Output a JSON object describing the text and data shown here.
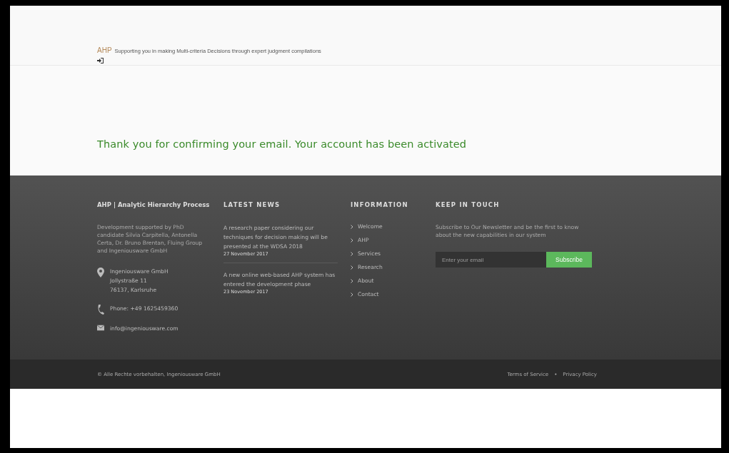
{
  "header": {
    "brand": "AHP",
    "tagline": "Supporting you in making Multi-criteria Decisions through expert judgment compilations"
  },
  "message": "Thank you for confirming your email. Your account has been activated",
  "footer": {
    "about": {
      "title": "AHP | Analytic Hierarchy Process",
      "text": "Development supported by PhD candidate Silvia Carpitella, Antonella Certa, Dr. Bruno Brentan, Fluing Group and Ingeniousware GmbH",
      "address": [
        "Ingeniousware GmbH",
        "Jollystraße 11",
        "76137, Karlsruhe"
      ],
      "phone": "Phone: +49 1625459360",
      "email": "info@ingeniousware.com"
    },
    "news": {
      "title": "LATEST NEWS",
      "items": [
        {
          "text": "A research paper considering our techniques for decision making will be presented at the WDSA 2018",
          "date": "27 November 2017"
        },
        {
          "text": "A new online web-based AHP system has entered the development phase",
          "date": "23 November 2017"
        }
      ]
    },
    "information": {
      "title": "INFORMATION",
      "links": [
        "Welcome",
        "AHP",
        "Services",
        "Research",
        "About",
        "Contact"
      ]
    },
    "newsletter": {
      "title": "KEEP IN TOUCH",
      "text": "Subscribe to Our Newsletter and be the first to know about the new capabilities in our system",
      "placeholder": "Enter your email",
      "button": "Subscribe"
    }
  },
  "bottom_bar": {
    "copyright": "© Alle Rechte vorbehalten, Ingeniousware GmbH",
    "links": [
      "Terms of Service",
      "Privacy Policy"
    ],
    "separator": "•"
  }
}
